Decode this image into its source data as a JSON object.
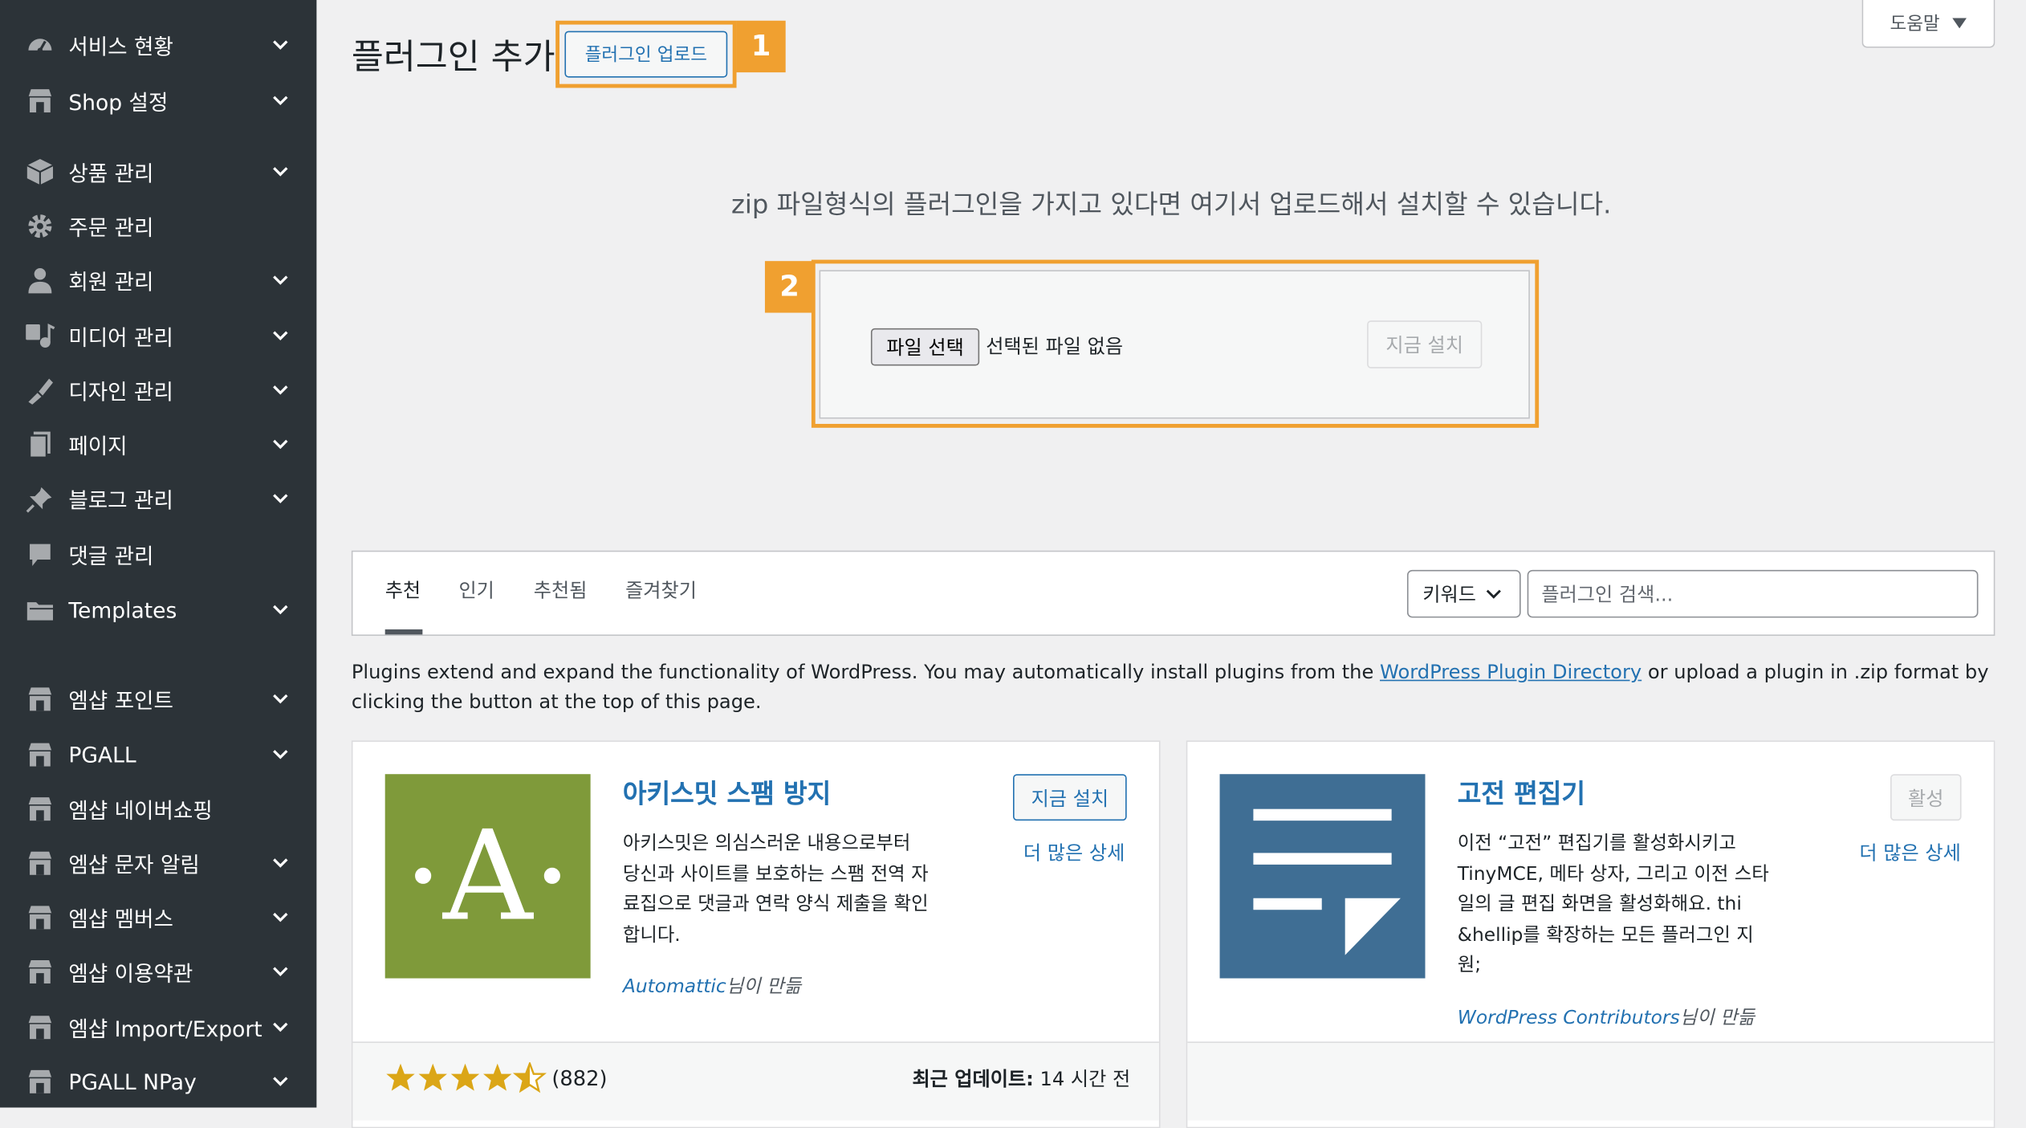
{
  "sidebar": {
    "items": [
      {
        "label": "서비스 현황",
        "icon": "dashboard-icon",
        "has_submenu": true
      },
      {
        "label": "Shop 설정",
        "icon": "shop-icon",
        "has_submenu": true
      },
      {
        "label": "상품 관리",
        "icon": "product-box-icon",
        "has_submenu": true
      },
      {
        "label": "주문 관리",
        "icon": "gear-icon",
        "has_submenu": false
      },
      {
        "label": "회원 관리",
        "icon": "user-icon",
        "has_submenu": true
      },
      {
        "label": "미디어 관리",
        "icon": "media-icon",
        "has_submenu": true
      },
      {
        "label": "디자인 관리",
        "icon": "brush-icon",
        "has_submenu": true
      },
      {
        "label": "페이지",
        "icon": "page-icon",
        "has_submenu": true
      },
      {
        "label": "블로그 관리",
        "icon": "pin-icon",
        "has_submenu": true
      },
      {
        "label": "댓글 관리",
        "icon": "comment-icon",
        "has_submenu": false
      },
      {
        "label": "Templates",
        "icon": "folder-icon",
        "has_submenu": true
      },
      {
        "label": "엠샵 포인트",
        "icon": "shop-icon",
        "has_submenu": true
      },
      {
        "label": "PGALL",
        "icon": "shop-icon",
        "has_submenu": true
      },
      {
        "label": "엠샵 네이버쇼핑",
        "icon": "shop-icon",
        "has_submenu": false
      },
      {
        "label": "엠샵 문자 알림",
        "icon": "shop-icon",
        "has_submenu": true
      },
      {
        "label": "엠샵 멤버스",
        "icon": "shop-icon",
        "has_submenu": true
      },
      {
        "label": "엠샵 이용약관",
        "icon": "shop-icon",
        "has_submenu": true
      },
      {
        "label": "엠샵 Import/Export",
        "icon": "shop-icon",
        "has_submenu": true
      },
      {
        "label": "PGALL NPay",
        "icon": "shop-icon",
        "has_submenu": true
      }
    ]
  },
  "header": {
    "title": "플러그인 추가",
    "upload_button": "플러그인 업로드",
    "help_button": "도움말"
  },
  "annotations": {
    "badge1": "1",
    "badge2": "2",
    "color": "#f0a030"
  },
  "upload": {
    "description": "zip 파일형식의 플러그인을 가지고 있다면 여기서 업로드해서 설치할 수 있습니다.",
    "file_button": "파일 선택",
    "file_status": "선택된 파일 없음",
    "install_button": "지금 설치"
  },
  "filter": {
    "tabs": [
      "추천",
      "인기",
      "추천됨",
      "즐겨찾기"
    ],
    "current_tab": "추천",
    "search_type": "키워드",
    "search_placeholder": "플러그인 검색..."
  },
  "intro": {
    "before": "Plugins extend and expand the functionality of WordPress. You may automatically install plugins from the ",
    "link": "WordPress Plugin Directory",
    "after": " or upload a plugin in .zip format by clicking the button at the top of this page."
  },
  "plugins": [
    {
      "name": "아키스밋 스팸 방지",
      "description": "아키스밋은 의심스러운 내용으로부터 당신과 사이트를 보호하는 스팸 전역 자료집으로 댓글과 연락 양식 제출을 확인합니다.",
      "author": "Automattic",
      "author_suffix": "님이 만듦",
      "action": "지금 설치",
      "more": "더 많은 상세",
      "rating": 4.5,
      "rating_count": "(882)",
      "updated_label": "최근 업데이트:",
      "updated_value": "14 시간 전",
      "icon_letter": "·A·",
      "icon_bg": "#7f9a3a"
    },
    {
      "name": "고전 편집기",
      "description": "이전 “고전” 편집기를 활성화시키고 TinyMCE, 메타 상자, 그리고 이전 스타일의 글 편집 화면을 활성화해요. thi &hellip를 확장하는 모든 플러그인 지원;",
      "author": "WordPress Contributors",
      "author_suffix": "님이 만듦",
      "action": "활성",
      "more": "더 많은 상세",
      "icon_bg": "#3f6e94"
    }
  ],
  "colors": {
    "sidebar_bg": "#2c3338",
    "link": "#2271b1",
    "highlight": "#f0a030",
    "star": "#dba617"
  }
}
